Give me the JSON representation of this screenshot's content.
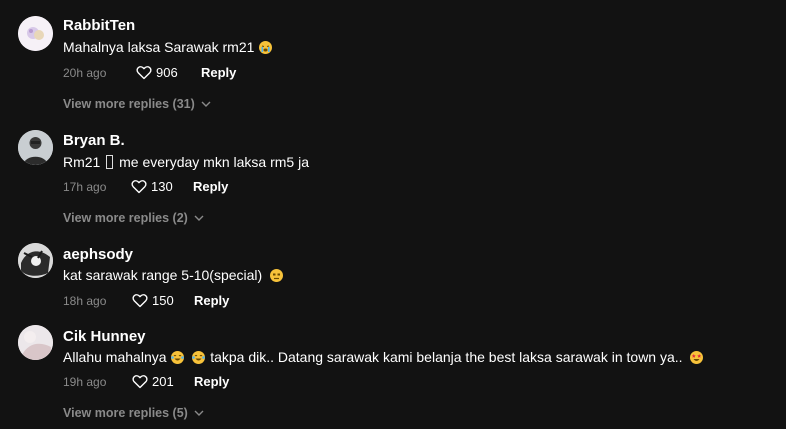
{
  "comments": [
    {
      "username": "RabbitTen",
      "text": "Mahalnya laksa Sarawak rm21",
      "emojis": [
        "crying-face"
      ],
      "time": "20h ago",
      "likes": "906",
      "reply_label": "Reply",
      "view_more": "View more replies (31)"
    },
    {
      "username": "Bryan B.",
      "text_before": "Rm21",
      "text_after": "me everyday mkn laksa rm5 ja",
      "time": "17h ago",
      "likes": "130",
      "reply_label": "Reply",
      "view_more": "View more replies (2)"
    },
    {
      "username": "aephsody",
      "text": "kat sarawak range 5-10(special)",
      "emojis": [
        "unamused-face"
      ],
      "time": "18h ago",
      "likes": "150",
      "reply_label": "Reply"
    },
    {
      "username": "Cik Hunney",
      "text_start": "Allahu mahalnya",
      "text_end": "takpa dik.. Datang sarawak kami belanja the best laksa sarawak in town ya..",
      "emojis": [
        "tears-of-joy",
        "tears-of-joy",
        "star-struck"
      ],
      "time": "19h ago",
      "likes": "201",
      "reply_label": "Reply",
      "view_more": "View more replies (5)"
    }
  ],
  "colors": {
    "background": "#121212",
    "primary_text": "#ffffff",
    "secondary_text": "#8a8a8a"
  }
}
